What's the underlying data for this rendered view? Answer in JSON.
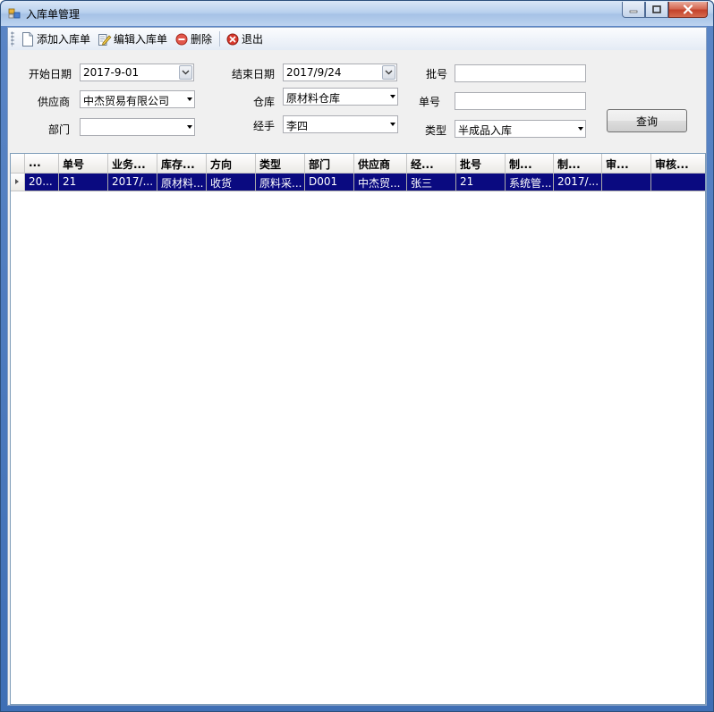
{
  "window": {
    "title": "入库单管理"
  },
  "toolbar": {
    "add_label": "添加入库单",
    "edit_label": "编辑入库单",
    "delete_label": "删除",
    "exit_label": "退出"
  },
  "filters": {
    "start_date": {
      "label": "开始日期",
      "value": "2017-9-01"
    },
    "end_date": {
      "label": "结束日期",
      "value": "2017/9/24"
    },
    "batch_no": {
      "label": "批号",
      "value": ""
    },
    "supplier": {
      "label": "供应商",
      "value": "中杰贸易有限公司"
    },
    "warehouse": {
      "label": "仓库",
      "value": "原材料仓库"
    },
    "order_no": {
      "label": "单号",
      "value": ""
    },
    "department": {
      "label": "部门",
      "value": ""
    },
    "handler": {
      "label": "经手",
      "value": "李四"
    },
    "type": {
      "label": "类型",
      "value": "半成品入库"
    },
    "query_label": "查询"
  },
  "grid": {
    "columns": [
      "...",
      "单号",
      "业务...",
      "库存...",
      "方向",
      "类型",
      "部门",
      "供应商",
      "经...",
      "批号",
      "制...",
      "制...",
      "审...",
      "审核..."
    ],
    "rows": [
      [
        "20...",
        "21",
        "2017/...",
        "原材料...",
        "收货",
        "原料采...",
        "D001",
        "中杰贸...",
        "张三",
        "21",
        "系统管...",
        "2017/...",
        "",
        ""
      ]
    ]
  }
}
